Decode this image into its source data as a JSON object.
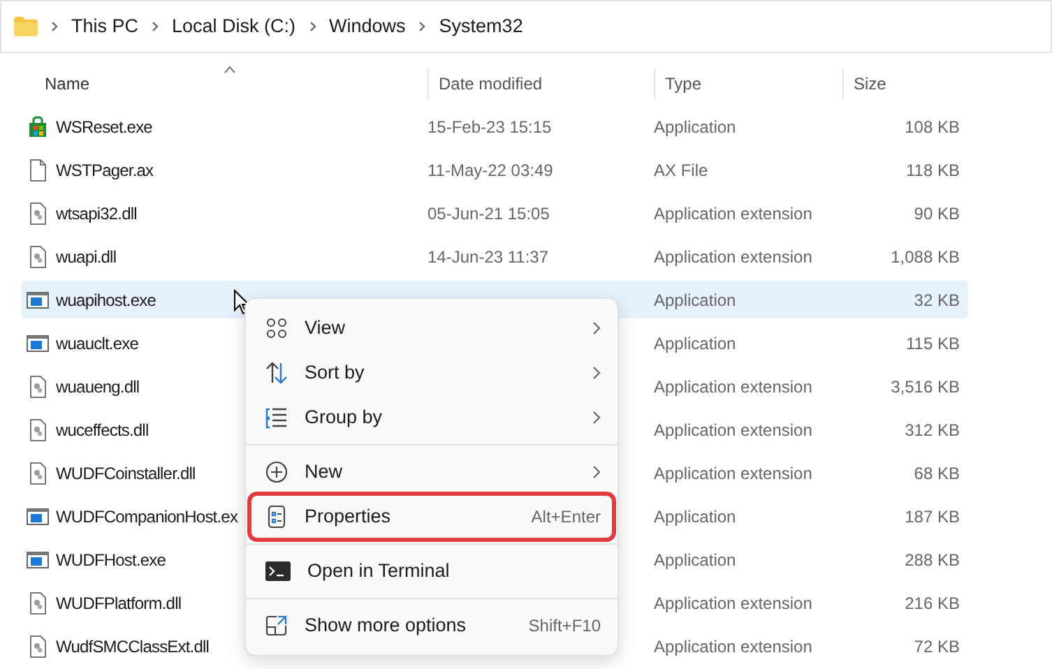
{
  "breadcrumb": [
    "This PC",
    "Local Disk (C:)",
    "Windows",
    "System32"
  ],
  "columns": [
    {
      "label": "Name",
      "sorted": true
    },
    {
      "label": "Date modified",
      "sorted": false
    },
    {
      "label": "Type",
      "sorted": false
    },
    {
      "label": "Size",
      "sorted": false
    }
  ],
  "rows": [
    {
      "kind": "store",
      "name": "WSReset.exe",
      "date": "15-Feb-23 15:15",
      "type": "Application",
      "size": "108 KB",
      "selected": false
    },
    {
      "kind": "blank",
      "name": "WSTPager.ax",
      "date": "11-May-22 03:49",
      "type": "AX File",
      "size": "118 KB",
      "selected": false
    },
    {
      "kind": "dll",
      "name": "wtsapi32.dll",
      "date": "05-Jun-21 15:05",
      "type": "Application extension",
      "size": "90 KB",
      "selected": false
    },
    {
      "kind": "dll",
      "name": "wuapi.dll",
      "date": "14-Jun-23 11:37",
      "type": "Application extension",
      "size": "1,088 KB",
      "selected": false
    },
    {
      "kind": "exe",
      "name": "wuapihost.exe",
      "type": "Application",
      "size": "32 KB",
      "selected": true
    },
    {
      "kind": "exe",
      "name": "wuauclt.exe",
      "type": "Application",
      "size": "115 KB",
      "selected": false
    },
    {
      "kind": "dll",
      "name": "wuaueng.dll",
      "type": "Application extension",
      "size": "3,516 KB",
      "selected": false
    },
    {
      "kind": "dll",
      "name": "wuceffects.dll",
      "type": "Application extension",
      "size": "312 KB",
      "selected": false
    },
    {
      "kind": "dll",
      "name": "WUDFCoinstaller.dll",
      "type": "Application extension",
      "size": "68 KB",
      "selected": false
    },
    {
      "kind": "exe",
      "name": "WUDFCompanionHost.ex",
      "type": "Application",
      "size": "187 KB",
      "selected": false
    },
    {
      "kind": "exe",
      "name": "WUDFHost.exe",
      "type": "Application",
      "size": "288 KB",
      "selected": false
    },
    {
      "kind": "dll",
      "name": "WUDFPlatform.dll",
      "type": "Application extension",
      "size": "216 KB",
      "selected": false
    },
    {
      "kind": "dll",
      "name": "WudfSMCClassExt.dll",
      "type": "Application extension",
      "size": "72 KB",
      "selected": false
    }
  ],
  "context_menu": [
    {
      "kind": "view",
      "label": "View",
      "submenu": true,
      "outlined": false
    },
    {
      "kind": "sort",
      "label": "Sort by",
      "submenu": true,
      "outlined": false
    },
    {
      "kind": "group",
      "label": "Group by",
      "submenu": true,
      "outlined": false,
      "separator_after": true
    },
    {
      "kind": "new",
      "label": "New",
      "submenu": true,
      "outlined": false
    },
    {
      "kind": "properties",
      "label": "Properties",
      "shortcut": "Alt+Enter",
      "submenu": false,
      "outlined": true,
      "separator_after": true
    },
    {
      "kind": "terminal",
      "label": "Open in Terminal",
      "submenu": false,
      "outlined": false,
      "separator_after": true
    },
    {
      "kind": "more",
      "label": "Show more options",
      "shortcut": "Shift+F10",
      "submenu": false,
      "outlined": false
    }
  ]
}
